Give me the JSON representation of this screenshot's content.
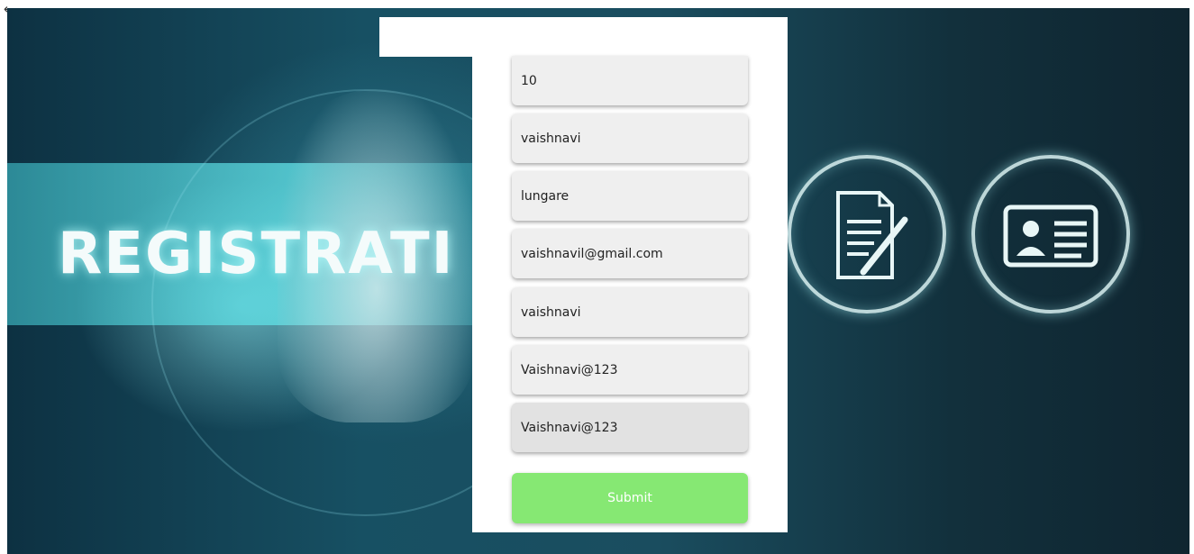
{
  "nav": {
    "back_icon_glyph": "←"
  },
  "hero": {
    "registration_text": "REGISTRATI",
    "icons": [
      "document-pen-icon",
      "id-card-icon"
    ]
  },
  "form": {
    "fields": [
      {
        "value": "10"
      },
      {
        "value": "vaishnavi"
      },
      {
        "value": "lungare"
      },
      {
        "value": "vaishnavil@gmail.com"
      },
      {
        "value": "vaishnavi"
      },
      {
        "value": "Vaishnavi@123"
      },
      {
        "value": "Vaishnavi@123"
      }
    ],
    "submit_label": "Submit"
  },
  "colors": {
    "submit_bg": "#86e873",
    "field_bg": "#efefef",
    "field_focused_bg": "#e2e2e2"
  }
}
